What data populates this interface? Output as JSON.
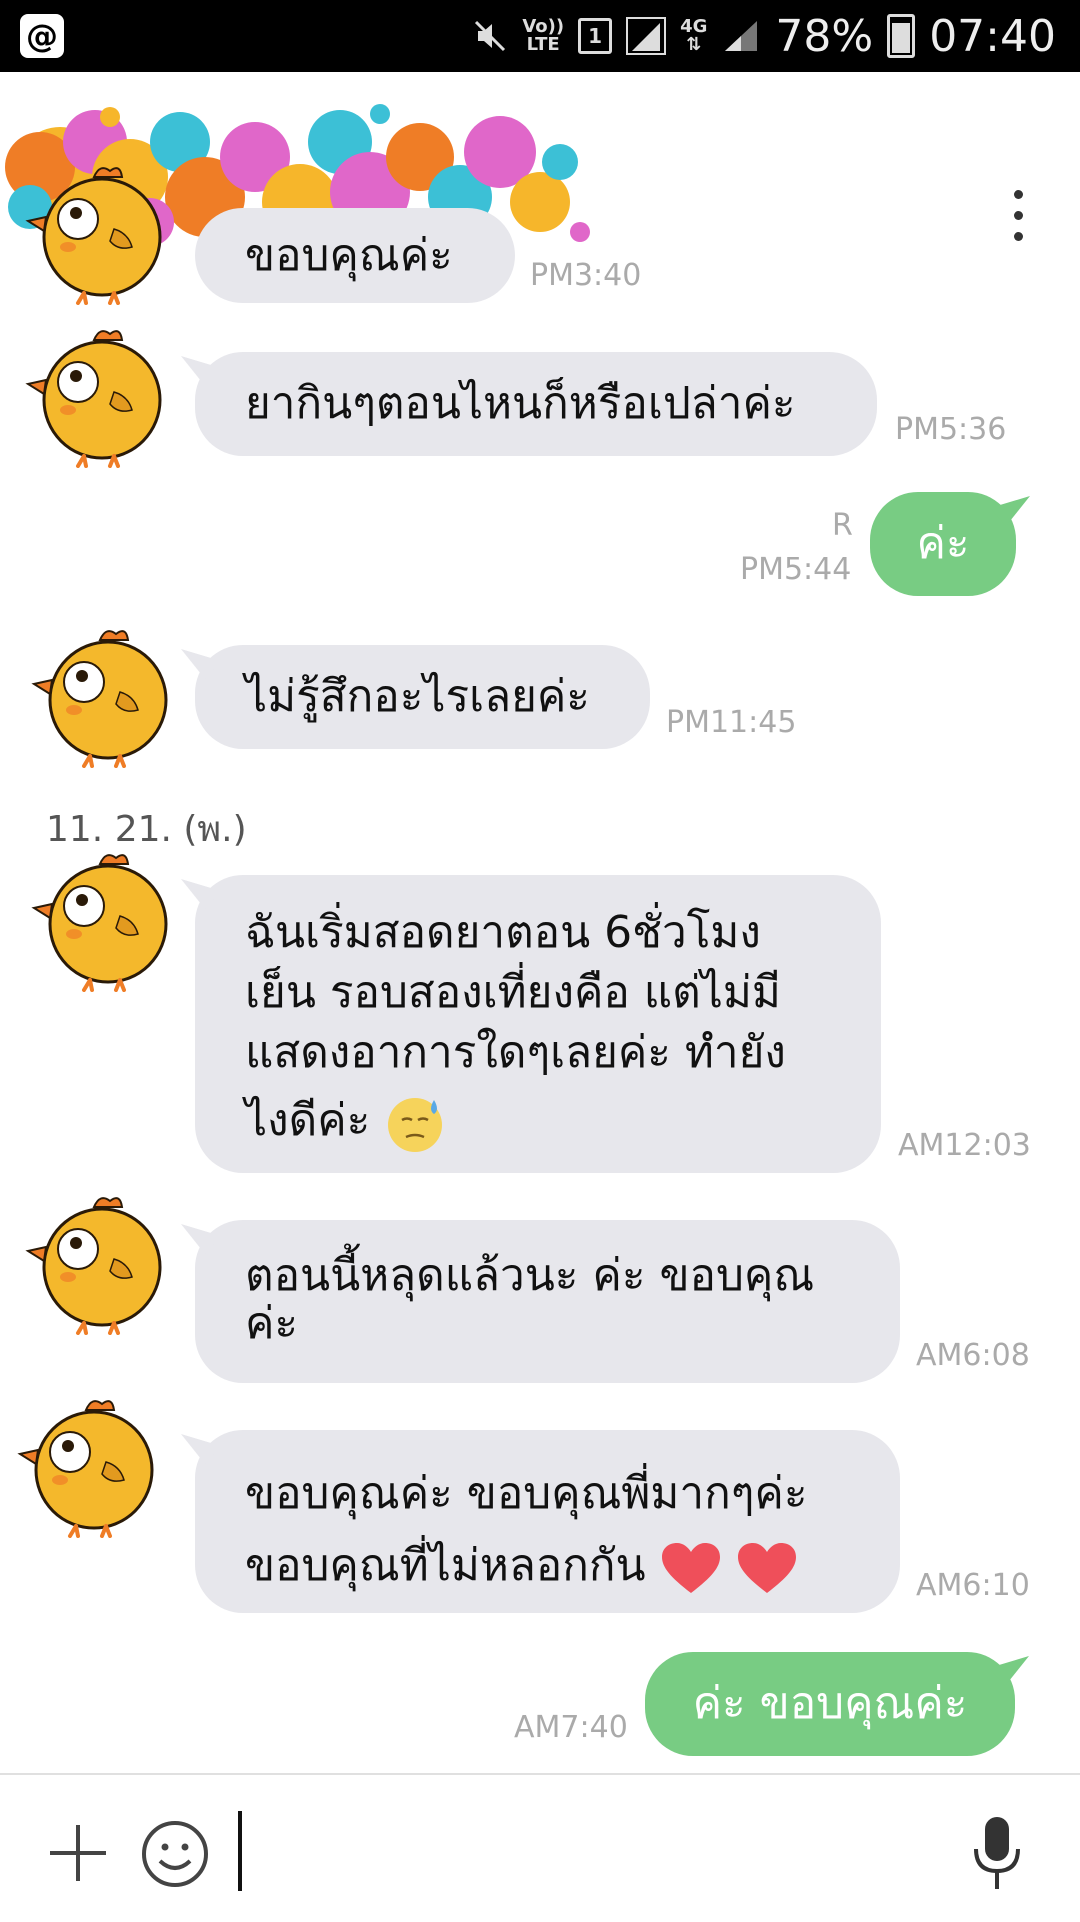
{
  "status_bar": {
    "app_icon": "@",
    "volte_top": "Vo))",
    "volte_bottom": "LTE",
    "sim_slot": "1",
    "network": "4G",
    "battery": "78%",
    "time": "07:40"
  },
  "icons": {
    "menu": "more-vert-icon",
    "plus": "plus-icon",
    "emoji": "smile-icon",
    "mic": "mic-icon"
  },
  "messages": [
    {
      "sender": "them",
      "text": "ขอบคุณค่ะ",
      "time": "PM3:40"
    },
    {
      "sender": "them",
      "text": "ยากินๆตอนไหนก็หรือเปล่าค่ะ",
      "time": "PM5:36"
    },
    {
      "sender": "me",
      "text": "ค่ะ",
      "time": "PM5:44",
      "read": "R"
    },
    {
      "sender": "them",
      "text": "ไม่รู้สึกอะไรเลยค่ะ",
      "time": "PM11:45"
    },
    {
      "sender": "them",
      "text_lines": [
        "ฉันเริ่มสอดยาตอน 6ชั่วโมง",
        "เย็น รอบสองเที่ยงคือ แต่ไม่มี",
        "แสดงอาการใดๆเลยค่ะ ทำยัง",
        "ไงดีค่ะ"
      ],
      "time": "AM12:03"
    },
    {
      "sender": "them",
      "text_lines": [
        "ตอนนี้หลุดแล้วนะ ค่ะ ขอบคุณ",
        "ค่ะ"
      ],
      "time": "AM6:08"
    },
    {
      "sender": "them",
      "text_lines": [
        "ขอบคุณค่ะ ขอบคุณพี่มากๆค่ะ",
        "ขอบคุณที่ไม่หลอกกัน"
      ],
      "time": "AM6:10"
    },
    {
      "sender": "me",
      "text": "ค่ะ ขอบคุณค่ะ",
      "time": "AM7:40"
    }
  ],
  "date_separator": "11. 21. (พ.)",
  "input": {
    "value": "",
    "placeholder": ""
  },
  "colors": {
    "bubble_incoming": "#e7e7ec",
    "bubble_outgoing": "#78cc83",
    "timestamp": "#aaaaaa"
  }
}
